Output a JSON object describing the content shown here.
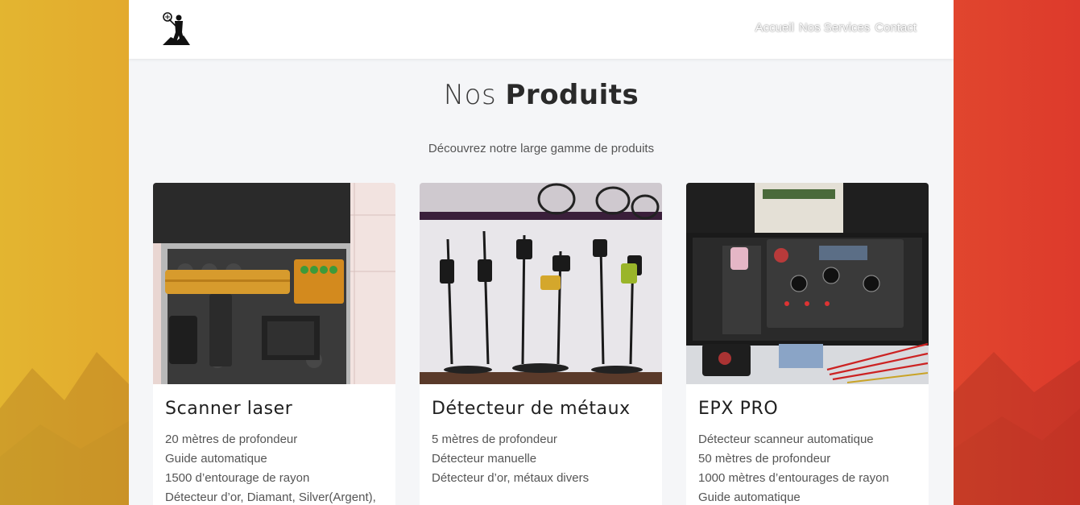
{
  "nav": {
    "links": [
      "Accueil",
      "Nos Services",
      "Contact"
    ]
  },
  "section": {
    "title_light": "Nos",
    "title_bold": "Produits",
    "subtitle": "Découvrez notre large gamme de produits"
  },
  "products": [
    {
      "title": "Scanner laser",
      "lines": [
        "20 mètres de profondeur",
        "Guide automatique",
        "1500 d’entourage de rayon",
        "Détecteur d’or, Diamant, Silver(Argent),"
      ]
    },
    {
      "title": "Détecteur de métaux",
      "lines": [
        "5 mètres de profondeur",
        "Détecteur manuelle",
        "Détecteur d’or, métaux divers"
      ]
    },
    {
      "title": "EPX PRO",
      "lines": [
        "Détecteur scanneur automatique",
        "50 mètres de profondeur",
        "1000 mètres d’entourages de rayon",
        "Guide automatique"
      ]
    }
  ],
  "colors": {
    "bg_left": "#e3b530",
    "bg_right": "#dd3a2c",
    "container_bg": "#f5f6f8",
    "text_dark": "#2a2a2a",
    "text_muted": "#555555"
  },
  "icons": {
    "logo": "miner-with-detector-logo"
  }
}
